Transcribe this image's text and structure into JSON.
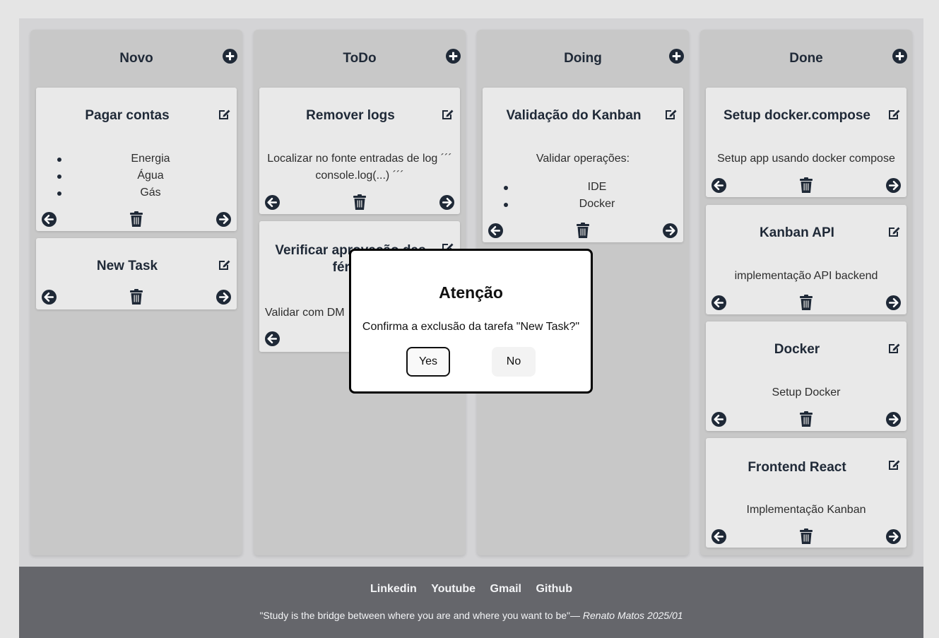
{
  "columns": [
    {
      "title": "Novo",
      "cards": [
        {
          "title": "Pagar contas",
          "items": [
            "Energia",
            "Água",
            "Gás"
          ]
        },
        {
          "title": "New Task"
        }
      ]
    },
    {
      "title": "ToDo",
      "cards": [
        {
          "title": "Remover logs",
          "description": "Localizar no fonte entradas de log ´´´ console.log(...) ´´´"
        },
        {
          "title": "Verificar aprovação das férias",
          "description": "Validar com DM"
        }
      ]
    },
    {
      "title": "Doing",
      "cards": [
        {
          "title": "Validação do Kanban",
          "description": "Validar operações:",
          "items": [
            "IDE",
            "Docker"
          ]
        }
      ]
    },
    {
      "title": "Done",
      "cards": [
        {
          "title": "Setup docker.compose",
          "description": "Setup app usando docker compose"
        },
        {
          "title": "Kanban API",
          "description": "implementação API backend"
        },
        {
          "title": "Docker",
          "description": "Setup Docker"
        },
        {
          "title": "Frontend React",
          "description": "Implementação Kanban"
        }
      ]
    }
  ],
  "modal": {
    "title": "Atenção",
    "message": "Confirma a exclusão da tarefa \"New Task?\"",
    "yes_label": "Yes",
    "no_label": "No"
  },
  "footer": {
    "links": [
      "Linkedin",
      "Youtube",
      "Gmail",
      "Github"
    ],
    "quote": "\"Study is the bridge between where you are and where you want to be\"— ",
    "author": "Renato Matos 2025/01"
  },
  "colors": {
    "column_bg": "#c8c8c8",
    "card_bg": "#e9e9e9",
    "icon": "#1f2937",
    "footer_bg": "#65666b"
  },
  "icons": {
    "add": "plus-circle-icon",
    "edit": "edit-icon",
    "left": "arrow-left-circle-icon",
    "right": "arrow-right-circle-icon",
    "delete": "trash-icon"
  }
}
